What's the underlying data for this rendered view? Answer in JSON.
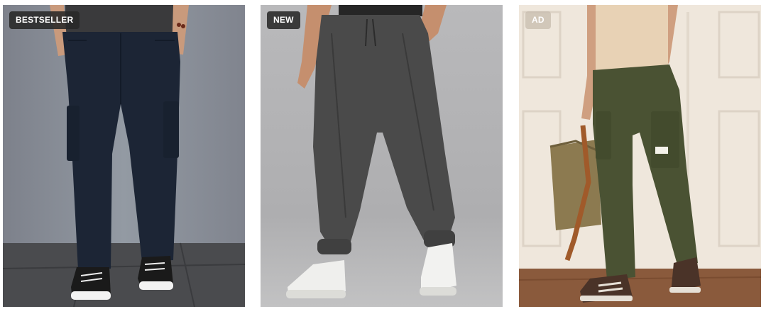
{
  "products": [
    {
      "badge": "BESTSELLER",
      "badge_style": "dark",
      "image": "navy-blue-cargo-pants-photo",
      "colors": {
        "background": "#868a94",
        "floor": "#4a4b4e",
        "garment": "#1c2535"
      }
    },
    {
      "badge": "NEW",
      "badge_style": "dark",
      "image": "charcoal-grey-jogger-pants-photo",
      "colors": {
        "background": "#b3b3b5",
        "garment": "#4a4a4a"
      }
    },
    {
      "badge": "AD",
      "badge_style": "light",
      "image": "olive-green-cargo-pants-photo",
      "colors": {
        "background": "#efe7dc",
        "floor": "#8a5a3c",
        "garment": "#4a5233"
      }
    }
  ]
}
